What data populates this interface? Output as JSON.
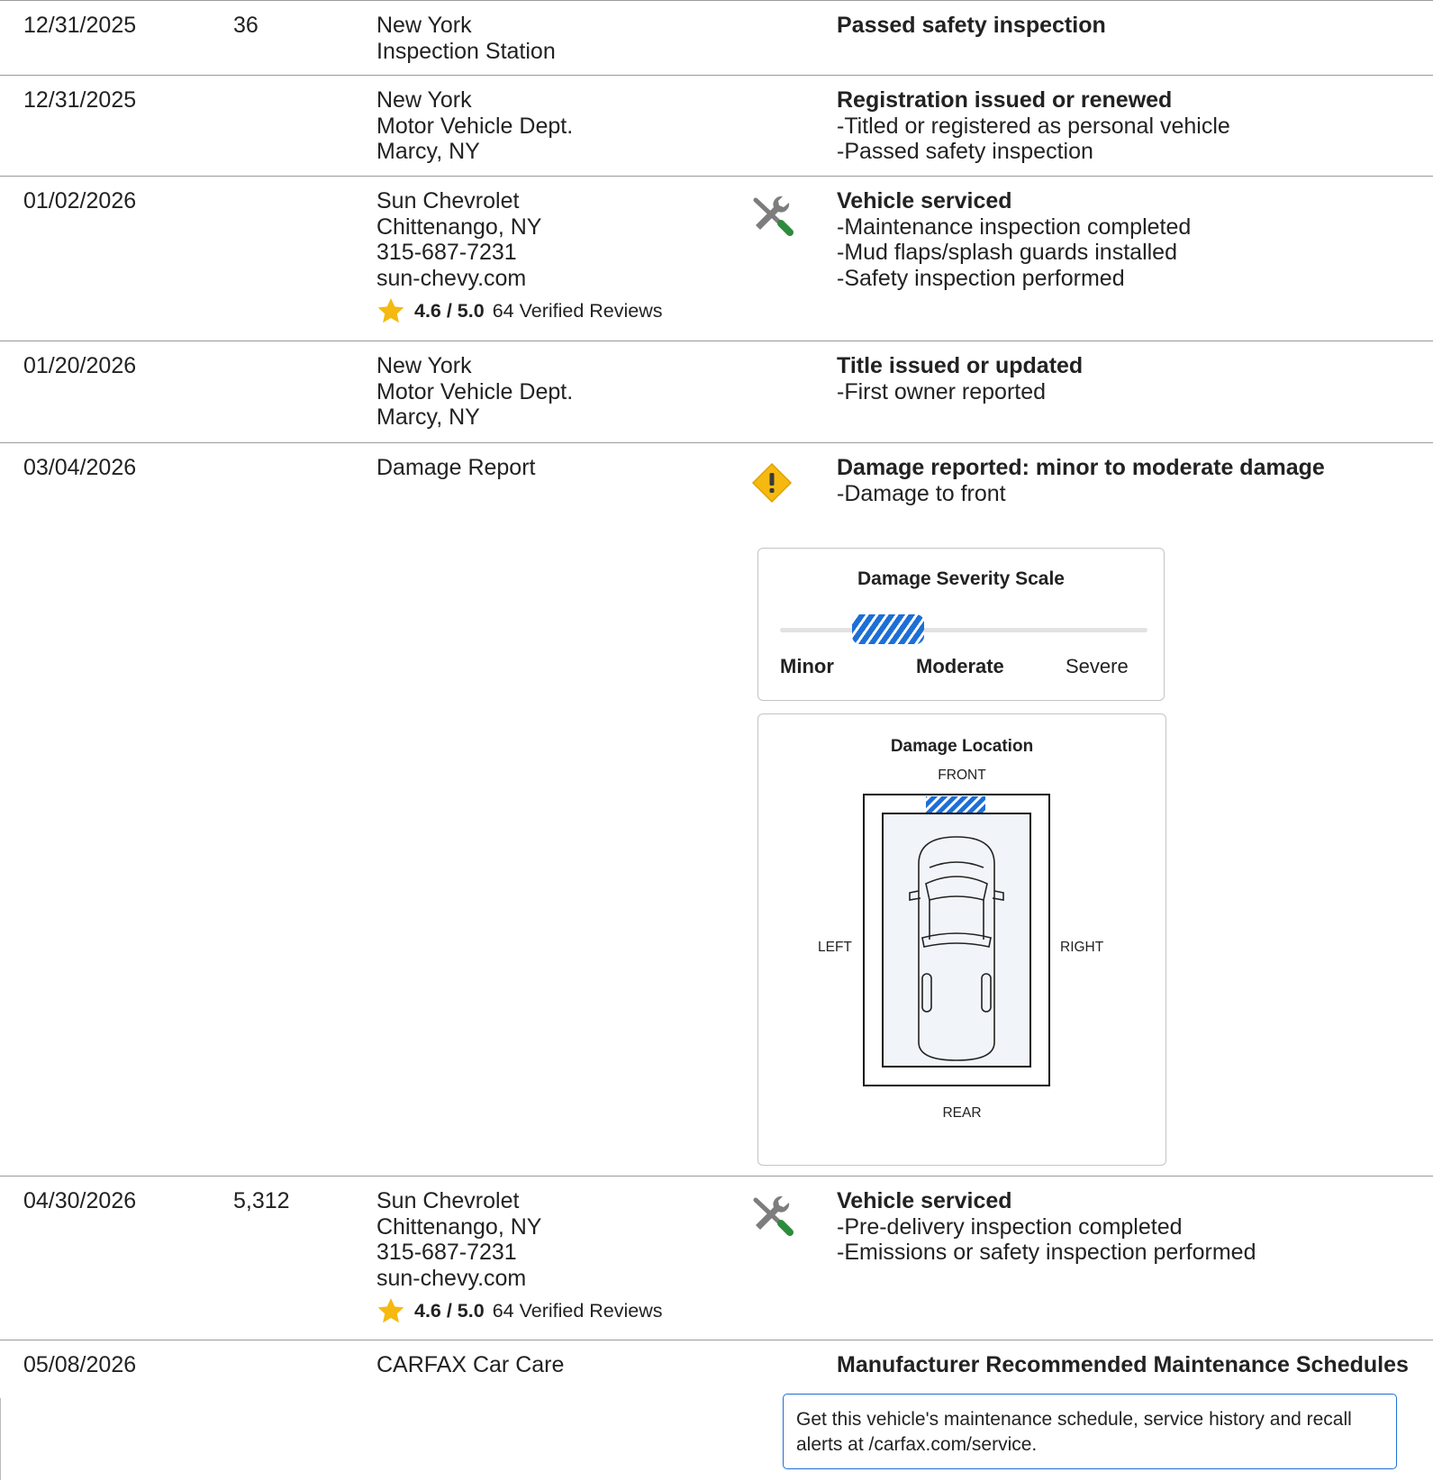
{
  "records": [
    {
      "date": "12/31/2025",
      "odometer": "36",
      "source": [
        "New York",
        "Inspection Station"
      ],
      "icon": null,
      "heading": "Passed safety inspection",
      "bullets": []
    },
    {
      "date": "12/31/2025",
      "odometer": "",
      "source": [
        "New York",
        "Motor Vehicle Dept.",
        "Marcy, NY"
      ],
      "icon": null,
      "heading": "Registration issued or renewed",
      "bullets": [
        "Titled or registered as personal vehicle",
        "Passed safety inspection"
      ]
    },
    {
      "date": "01/02/2026",
      "odometer": "",
      "source": [
        "Sun Chevrolet",
        "Chittenango, NY",
        "315-687-7231",
        "sun-chevy.com"
      ],
      "rating": {
        "score": "4.6 / 5.0",
        "reviews": "64 Verified Reviews"
      },
      "icon": "service-tools-icon",
      "heading": "Vehicle serviced",
      "bullets": [
        "Maintenance inspection completed",
        "Mud flaps/splash guards installed",
        "Safety inspection performed"
      ]
    },
    {
      "date": "01/20/2026",
      "odometer": "",
      "source": [
        "New York",
        "Motor Vehicle Dept.",
        "Marcy, NY"
      ],
      "icon": null,
      "heading": "Title issued or updated",
      "bullets": [
        "First owner reported"
      ]
    },
    {
      "date": "03/04/2026",
      "odometer": "",
      "source": [
        "Damage Report"
      ],
      "icon": "damage-warning-icon",
      "heading": "Damage reported: minor to moderate damage",
      "bullets": [
        "Damage to front"
      ]
    },
    {
      "date": "04/30/2026",
      "odometer": "5,312",
      "source": [
        "Sun Chevrolet",
        "Chittenango, NY",
        "315-687-7231",
        "sun-chevy.com"
      ],
      "rating": {
        "score": "4.6 / 5.0",
        "reviews": "64 Verified Reviews"
      },
      "icon": "service-tools-icon",
      "heading": "Vehicle serviced",
      "bullets": [
        "Pre-delivery inspection completed",
        "Emissions or safety inspection performed"
      ]
    },
    {
      "date": "05/08/2026",
      "odometer": "",
      "source": [
        "CARFAX Car Care"
      ],
      "icon": null,
      "heading": "Manufacturer Recommended Maintenance Schedules",
      "bullets": []
    }
  ],
  "severity_scale": {
    "title": "Damage Severity Scale",
    "labels": [
      "Minor",
      "Moderate",
      "Severe"
    ],
    "highlighted": [
      "Minor",
      "Moderate"
    ],
    "level": "minor-to-moderate",
    "fill_color": "#1d6fd6"
  },
  "damage_location": {
    "title": "Damage Location",
    "front": "FRONT",
    "rear": "REAR",
    "left": "LEFT",
    "right": "RIGHT",
    "damaged_area": "front",
    "highlight_color": "#1d6fd6"
  },
  "maintenance_cta": {
    "text": "Get this vehicle's maintenance schedule, service history and recall alerts at /carfax.com/service."
  },
  "colors": {
    "divider": "#9a9a9a",
    "accent_blue": "#1d6fd6",
    "star": "#f5b90f",
    "warning": "#f5b90f",
    "wrench_handle": "#2e8b3e"
  }
}
